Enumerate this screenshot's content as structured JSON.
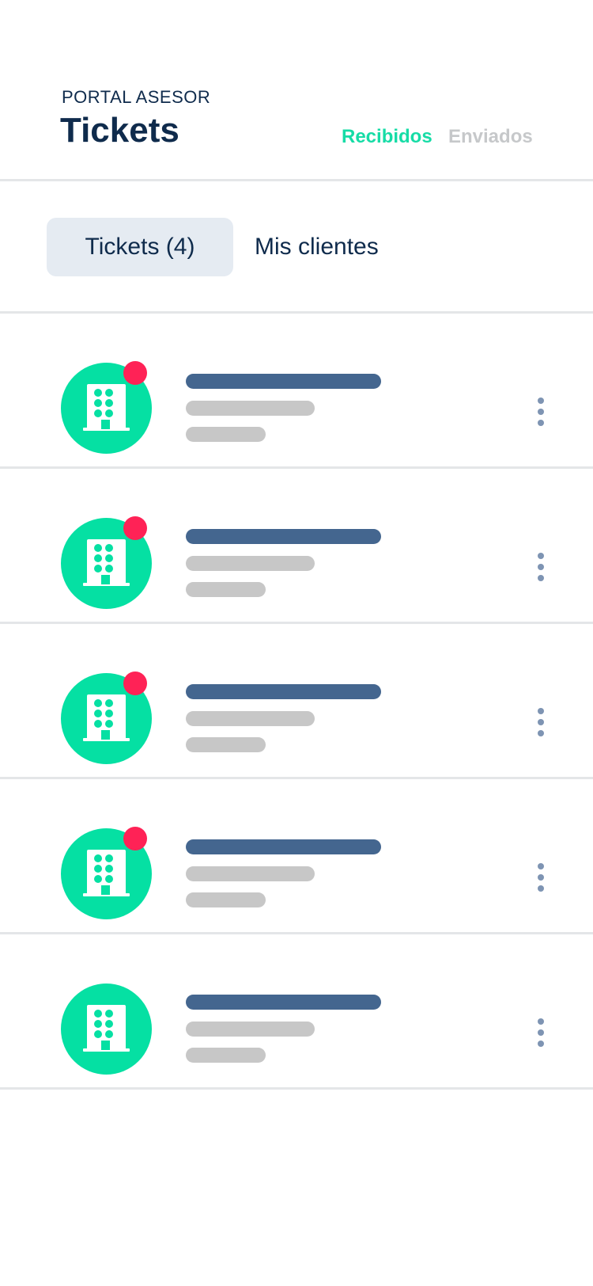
{
  "header": {
    "eyebrow": "PORTAL ASESOR",
    "title": "Tickets",
    "segments": {
      "received": "Recibidos",
      "sent": "Enviados"
    }
  },
  "tabs": {
    "tickets": "Tickets (4)",
    "clients": "Mis clientes"
  },
  "list": {
    "rows": [
      {
        "icon": "building-icon",
        "unread": true
      },
      {
        "icon": "building-icon",
        "unread": true
      },
      {
        "icon": "building-icon",
        "unread": true
      },
      {
        "icon": "building-icon",
        "unread": true
      },
      {
        "icon": "building-icon",
        "unread": false
      }
    ]
  },
  "colors": {
    "accent": "#16dca6",
    "avatar": "#05e0a3",
    "badge": "#ff2256",
    "navy": "#0f2b4c",
    "placeholder_primary": "#44668f",
    "placeholder_secondary": "#c7c7c7"
  }
}
